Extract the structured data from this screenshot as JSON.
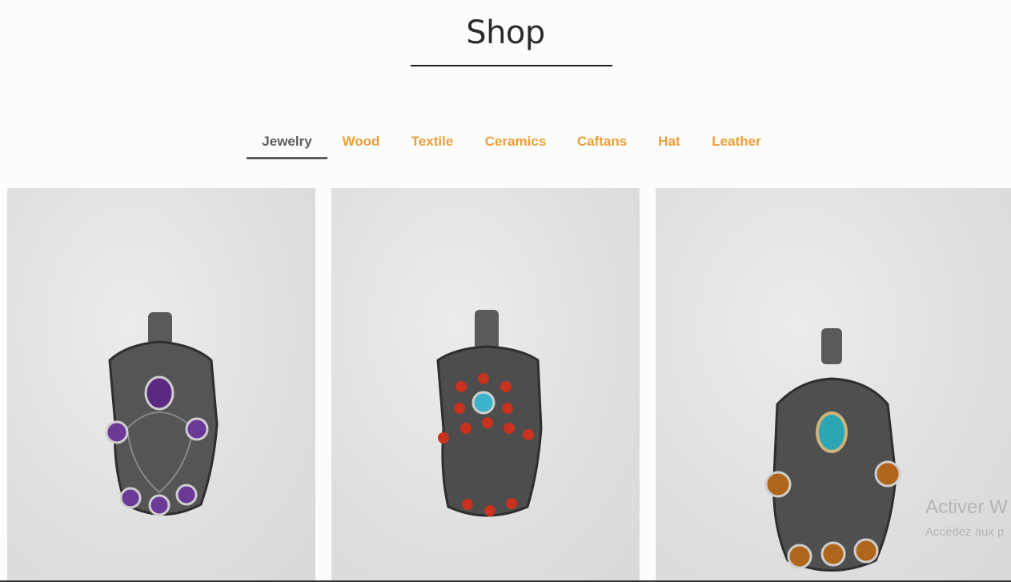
{
  "page": {
    "title": "Shop"
  },
  "tabs": [
    {
      "label": "Jewelry",
      "active": true
    },
    {
      "label": "Wood",
      "active": false
    },
    {
      "label": "Textile",
      "active": false
    },
    {
      "label": "Ceramics",
      "active": false
    },
    {
      "label": "Caftans",
      "active": false
    },
    {
      "label": "Hat",
      "active": false
    },
    {
      "label": "Leather",
      "active": false
    }
  ],
  "colors": {
    "accent": "#e9a03a",
    "active_tab": "#5c5c5c",
    "title": "#2b2b2b"
  },
  "products": [
    {
      "image": "hamsa-pendant-amethyst",
      "stone": "amethyst"
    },
    {
      "image": "hamsa-pendant-turquoise-coral",
      "stone": "turquoise-coral"
    },
    {
      "image": "hamsa-pendant-turquoise-amber",
      "stone": "turquoise-amber"
    }
  ],
  "watermark": {
    "title": "Activer W",
    "subtitle": "Accédez aux p"
  }
}
